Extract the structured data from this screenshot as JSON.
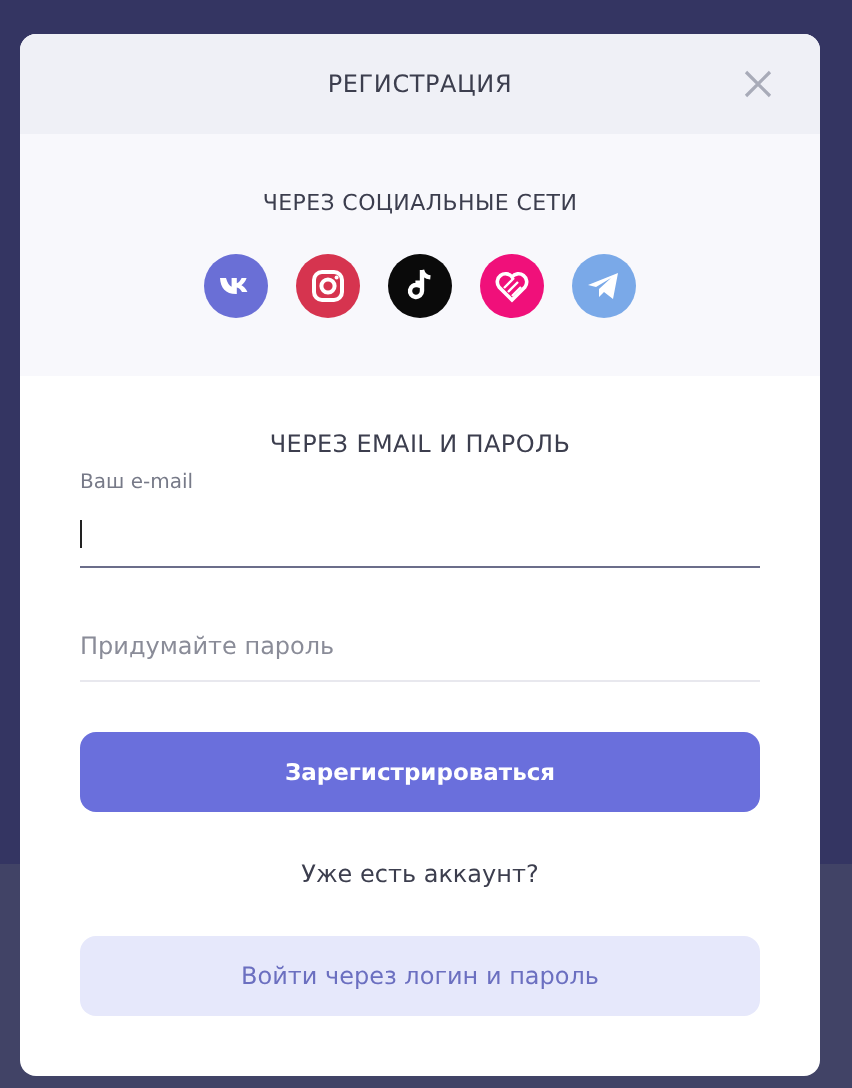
{
  "dialog": {
    "title": "РЕГИСТРАЦИЯ",
    "social": {
      "heading": "ЧЕРЕЗ СОЦИАЛЬНЫЕ СЕТИ",
      "networks": [
        {
          "kind": "vk",
          "color": "#6a6fd6"
        },
        {
          "kind": "camera",
          "color": "#d6344f"
        },
        {
          "kind": "note",
          "color": "#0a0a0a"
        },
        {
          "kind": "heart",
          "color": "#f0107a"
        },
        {
          "kind": "plane",
          "color": "#7aa9e8"
        }
      ]
    },
    "email_section": {
      "heading": "ЧЕРЕЗ EMAIL И ПАРОЛЬ",
      "fields": [
        {
          "label": "Ваш e-mail",
          "focused": true
        },
        {
          "placeholder": "Придумайте пароль",
          "focused": false
        }
      ],
      "submit": "Зарегистрироваться"
    },
    "login_prompt": "Уже есть аккаунт?",
    "login_button": "Войти через логин и пароль"
  }
}
